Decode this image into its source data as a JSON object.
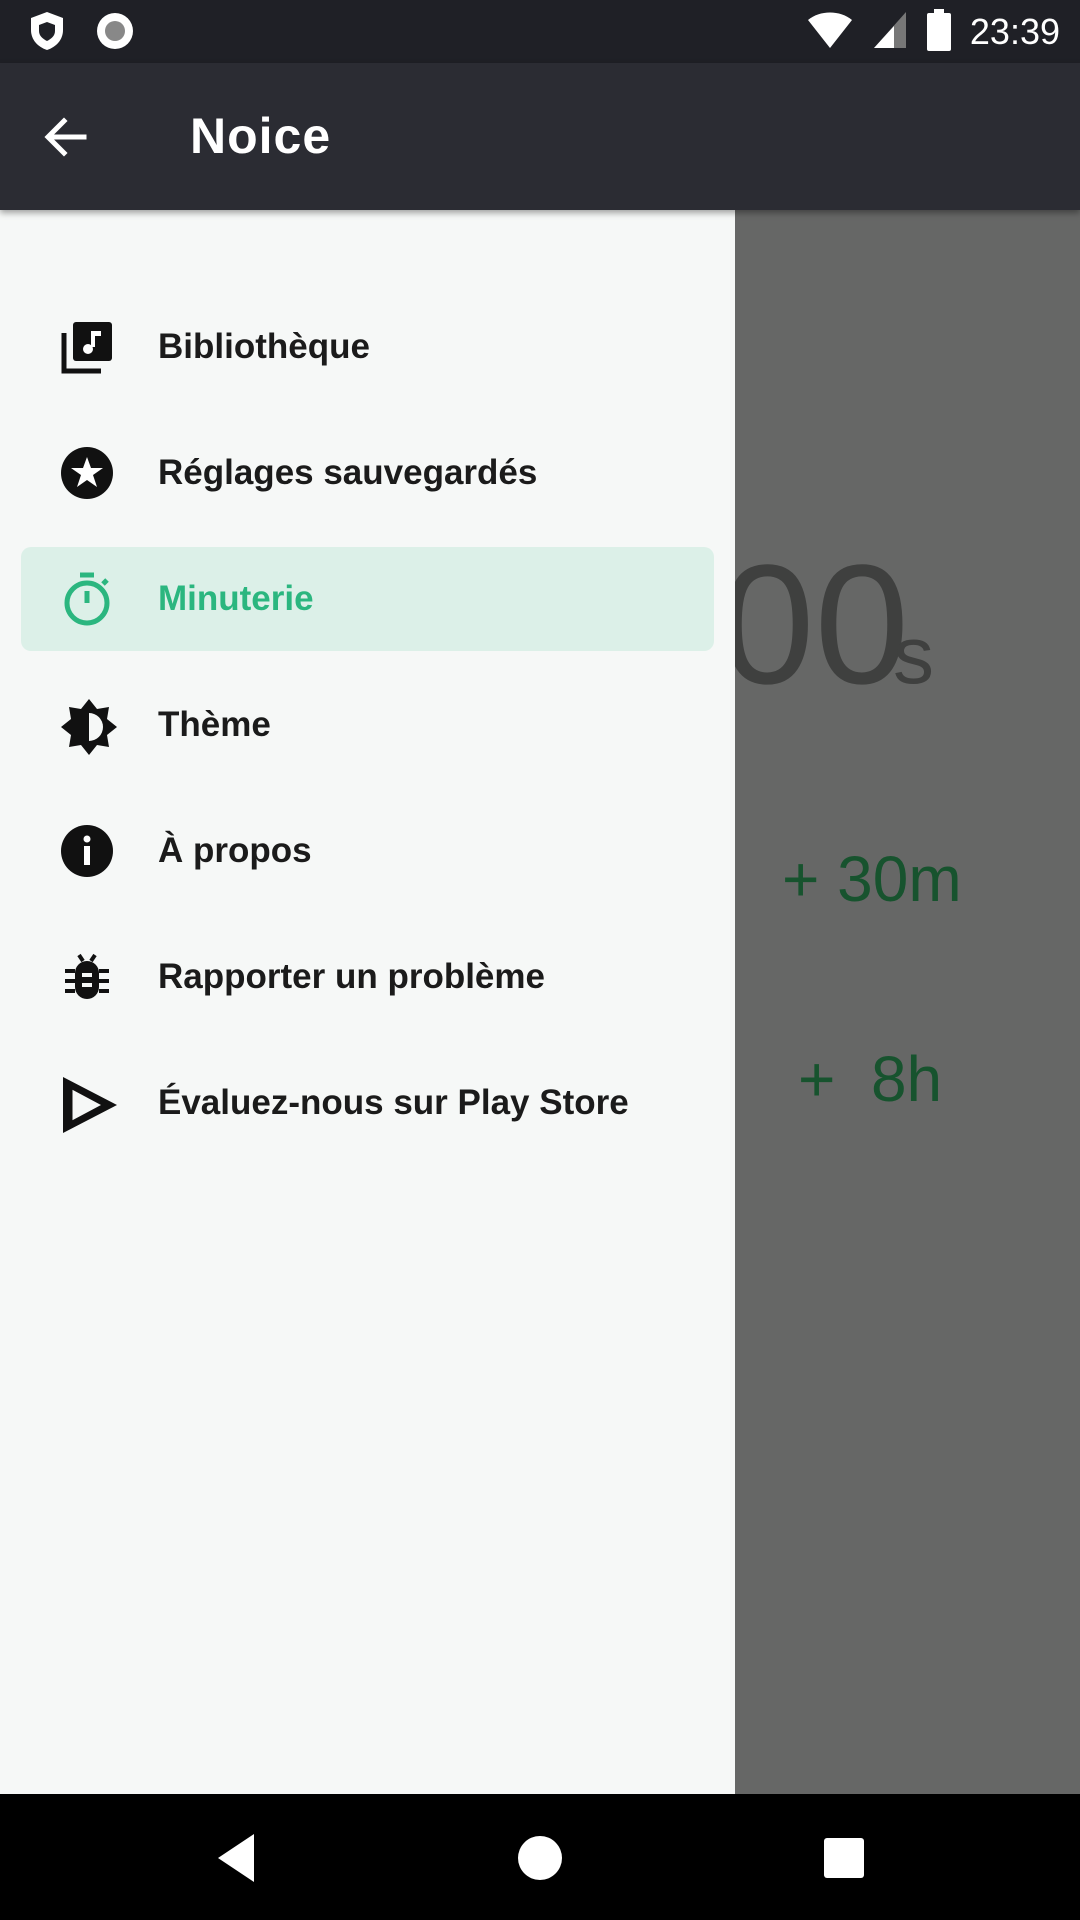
{
  "status_bar": {
    "time": "23:39",
    "left_icons": [
      "shield-icon",
      "record-icon"
    ],
    "right_icons": [
      "wifi-icon",
      "signal-icon",
      "battery-icon"
    ]
  },
  "toolbar": {
    "title": "Noice",
    "back_icon": "arrow-back-icon"
  },
  "drawer": {
    "items": [
      {
        "label": "Bibliothèque",
        "icon": "library-music-icon",
        "active": false
      },
      {
        "label": "Réglages sauvegardés",
        "icon": "star-circle-icon",
        "active": false
      },
      {
        "label": "Minuterie",
        "icon": "timer-icon",
        "active": true
      },
      {
        "label": "Thème",
        "icon": "brightness-icon",
        "active": false
      },
      {
        "label": "À propos",
        "icon": "info-icon",
        "active": false
      },
      {
        "label": "Rapporter un problème",
        "icon": "bug-icon",
        "active": false
      },
      {
        "label": "Évaluez-nous sur Play Store",
        "icon": "play-store-icon",
        "active": false
      }
    ],
    "active_color": "#2bb67f",
    "active_bg": "#dcf0e8"
  },
  "background": {
    "timer_digits": "00",
    "timer_unit": "s",
    "add_30m": "+ 30m",
    "add_8h": "+  8h"
  },
  "nav_bar": {
    "back_icon": "nav-back-icon",
    "home_icon": "nav-home-icon",
    "recents_icon": "nav-recents-icon"
  }
}
